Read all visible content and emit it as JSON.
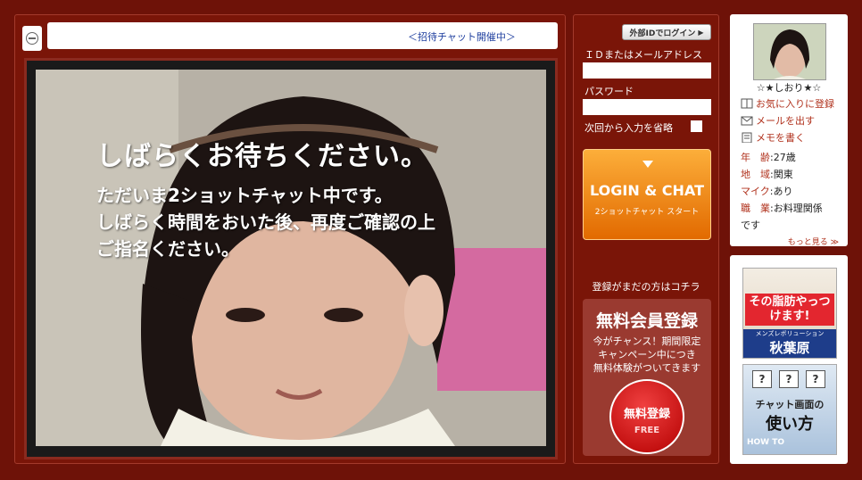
{
  "video": {
    "notice": "＜招待チャット開催中＞",
    "overlay_title": "しばらくお待ちください。",
    "overlay_lines": [
      "ただいま2ショットチャット中です。",
      "しばらく時間をおいた後、再度ご確認の上",
      "ご指名ください。"
    ]
  },
  "login": {
    "external_button": "外部IDでログイン",
    "id_label": "ＩＤまたはメールアドレス",
    "password_label": "パスワード",
    "remember_label": "次回から入力を省略",
    "login_main": "LOGIN & CHAT",
    "login_sub": "2ショットチャット スタート",
    "register_prompt": "登録がまだの方はコチラ",
    "register_title": "無料会員登録",
    "register_desc": [
      "今がチャンス！期間限定",
      "キャンペーン中につき",
      "無料体験がついてきます"
    ],
    "register_button_main": "無料登録",
    "register_button_sub": "FREE"
  },
  "profile": {
    "name": "☆★しおり★☆",
    "links": [
      {
        "label": "お気に入りに登録",
        "icon": "book-icon"
      },
      {
        "label": "メールを出す",
        "icon": "mail-icon"
      },
      {
        "label": "メモを書く",
        "icon": "memo-icon"
      }
    ],
    "rows": [
      {
        "key": "年　齢",
        "value": "27歳"
      },
      {
        "key": "地　域",
        "value": "関東"
      },
      {
        "key": "マイク",
        "value": "あり"
      },
      {
        "key": "職　業",
        "value": "お料理関係"
      }
    ],
    "occupation_wrap": "です",
    "more": "もっと見る ≫"
  },
  "ads": {
    "ad1_title": "その脂肪やっつけます!",
    "ad1_sub": "メンズレボリューション",
    "ad1_place": "秋葉原",
    "ad2_title": "チャット画面の",
    "ad2_big": "使い方",
    "ad2_sub": "HOW TO"
  },
  "colors": {
    "background": "#6e1208",
    "panel": "#7a1508",
    "accent": "#f28c1c",
    "link": "#b0311c"
  }
}
